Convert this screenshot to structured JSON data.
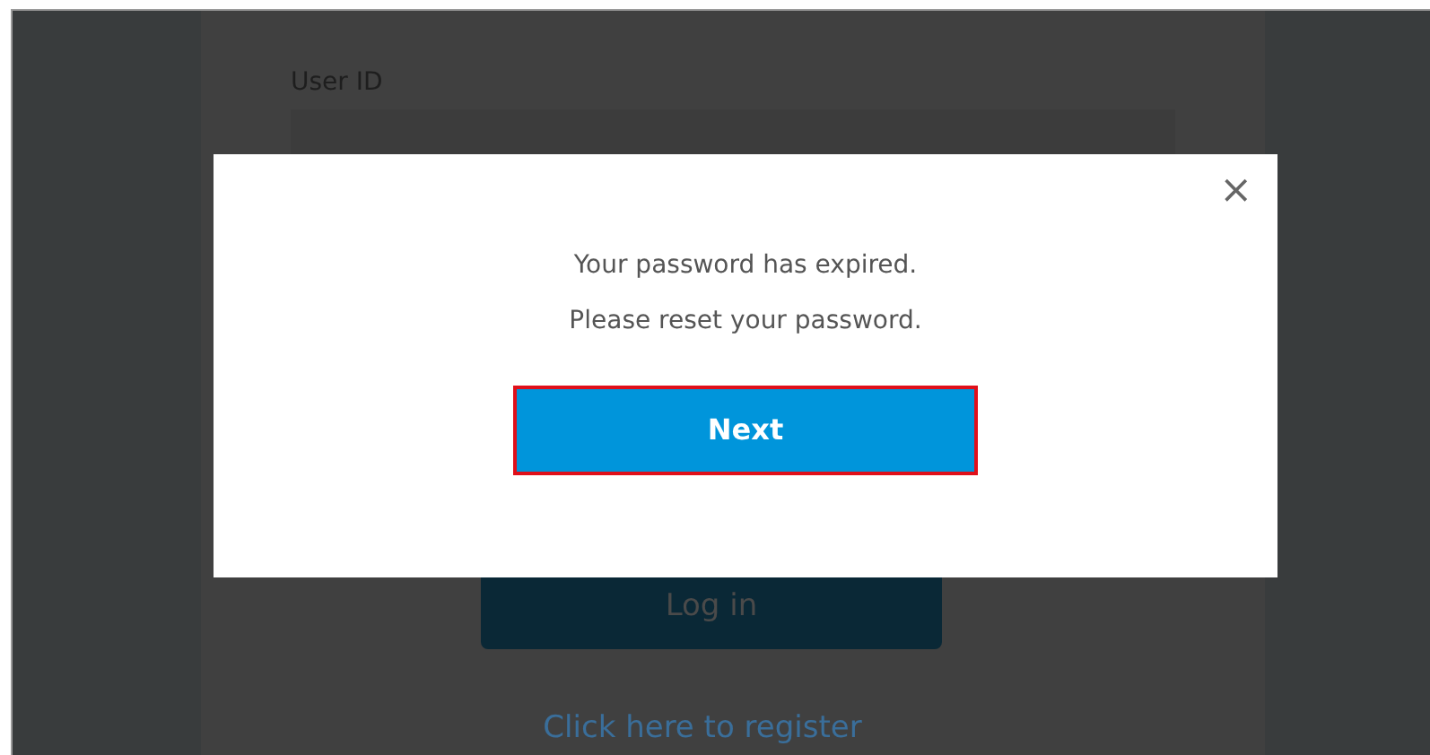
{
  "login_form": {
    "user_id_label": "User ID",
    "login_button": "Log in",
    "register_link": "Click here to register"
  },
  "dialog": {
    "close": "×",
    "message_lines": [
      "Your password has expired.",
      "Please reset your password."
    ],
    "next_button": "Next",
    "next_highlighted": true
  }
}
